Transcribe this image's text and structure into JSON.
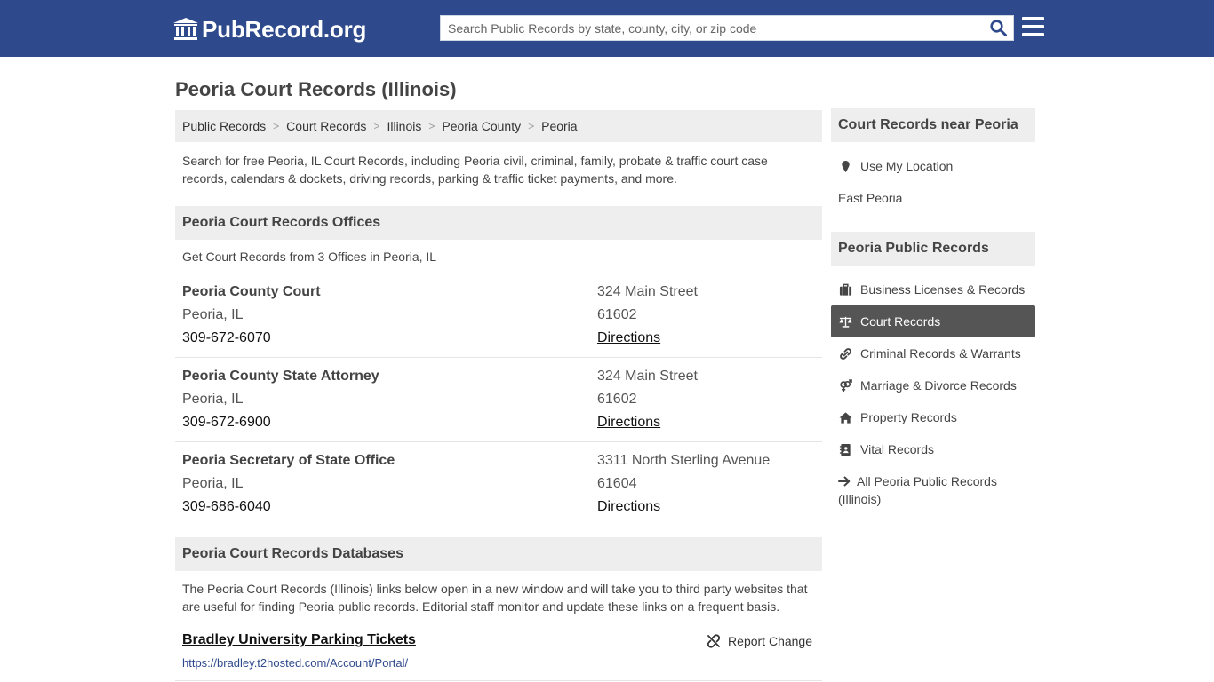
{
  "header": {
    "logo_text": "PubRecord.org",
    "search_placeholder": "Search Public Records by state, county, city, or zip code",
    "brand_color": "#2f4a8c"
  },
  "page": {
    "title": "Peoria Court Records (Illinois)"
  },
  "breadcrumb": [
    {
      "label": "Public Records"
    },
    {
      "label": "Court Records"
    },
    {
      "label": "Illinois"
    },
    {
      "label": "Peoria County"
    },
    {
      "label": "Peoria"
    }
  ],
  "intro": "Search for free Peoria, IL Court Records, including Peoria civil, criminal, family, probate & traffic court case records, calendars & dockets, driving records, parking & traffic ticket payments, and more.",
  "offices_section": {
    "title": "Peoria Court Records Offices",
    "subtitle": "Get Court Records from 3 Offices in Peoria, IL",
    "offices": [
      {
        "name": "Peoria County Court",
        "city": "Peoria, IL",
        "phone": "309-672-6070",
        "address": "324 Main Street",
        "zip": "61602",
        "directions": "Directions"
      },
      {
        "name": "Peoria County State Attorney",
        "city": "Peoria, IL",
        "phone": "309-672-6900",
        "address": "324 Main Street",
        "zip": "61602",
        "directions": "Directions"
      },
      {
        "name": "Peoria Secretary of State Office",
        "city": "Peoria, IL",
        "phone": "309-686-6040",
        "address": "3311 North Sterling Avenue",
        "zip": "61604",
        "directions": "Directions"
      }
    ]
  },
  "databases_section": {
    "title": "Peoria Court Records Databases",
    "description": "The Peoria Court Records (Illinois) links below open in a new window and will take you to third party websites that are useful for finding Peoria public records. Editorial staff monitor and update these links on a frequent basis.",
    "items": [
      {
        "title": "Bradley University Parking Tickets",
        "url": "https://bradley.t2hosted.com/Account/Portal/",
        "report_label": "Report Change"
      }
    ]
  },
  "sidebar": {
    "near": {
      "title": "Court Records near Peoria",
      "use_location": "Use My Location",
      "places": [
        "East Peoria"
      ]
    },
    "public_records": {
      "title": "Peoria Public Records",
      "items": [
        {
          "label": "Business Licenses & Records",
          "icon": "briefcase-icon",
          "active": false
        },
        {
          "label": "Court Records",
          "icon": "balance-scale-icon",
          "active": true
        },
        {
          "label": "Criminal Records & Warrants",
          "icon": "link-icon",
          "active": false
        },
        {
          "label": "Marriage & Divorce Records",
          "icon": "venus-mars-icon",
          "active": false
        },
        {
          "label": "Property Records",
          "icon": "home-icon",
          "active": false
        },
        {
          "label": "Vital Records",
          "icon": "address-book-icon",
          "active": false
        }
      ],
      "all_link": "All Peoria Public Records (Illinois)"
    }
  }
}
